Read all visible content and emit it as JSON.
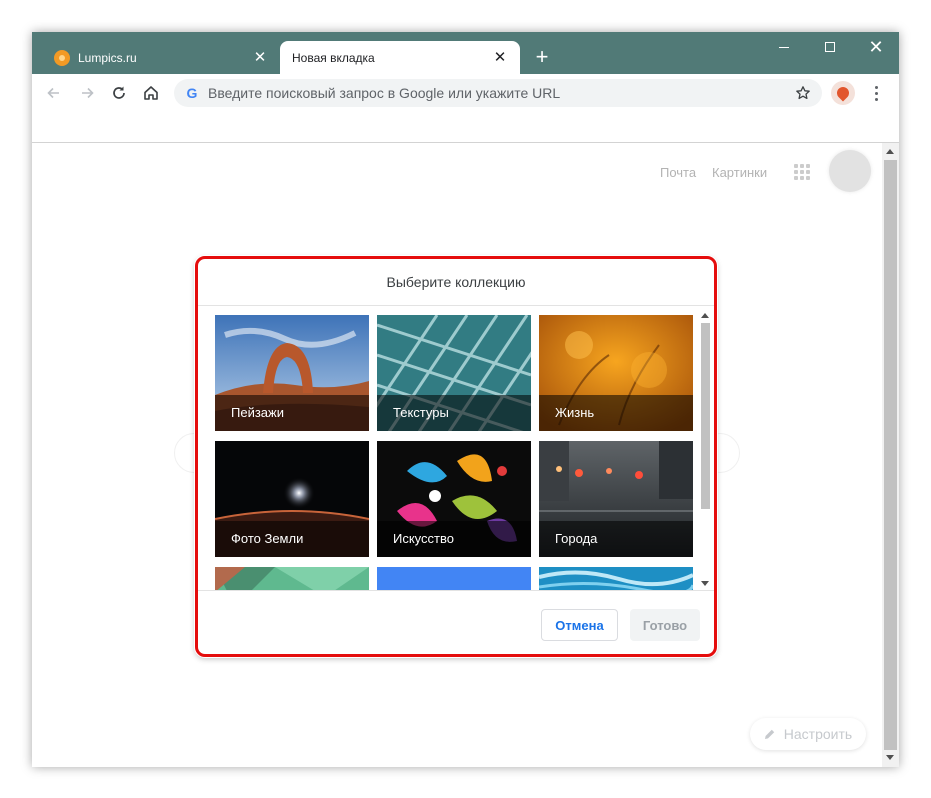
{
  "tabs": [
    {
      "title": "Lumpics.ru",
      "active": false
    },
    {
      "title": "Новая вкладка",
      "active": true
    }
  ],
  "new_tab_label": "+",
  "window_controls": {
    "minimize_icon": "minimize-icon",
    "maximize_icon": "maximize-icon",
    "close_icon": "close-icon",
    "close_glyph": "✕"
  },
  "toolbar": {
    "omnibox_placeholder": "Введите поисковый запрос в Google или укажите URL",
    "google_icon_glyph": "G"
  },
  "google_links": {
    "mail": "Почта",
    "images": "Картинки"
  },
  "dialog": {
    "title": "Выберите коллекцию",
    "collections": [
      {
        "label": "Пейзажи",
        "theme": "landscape-arch"
      },
      {
        "label": "Текстуры",
        "theme": "glass-texture"
      },
      {
        "label": "Жизнь",
        "theme": "autumn-orange"
      },
      {
        "label": "Фото Земли",
        "theme": "earth-from-space"
      },
      {
        "label": "Искусство",
        "theme": "paint-splash"
      },
      {
        "label": "Города",
        "theme": "rainy-city"
      },
      {
        "label": "",
        "theme": "geometric-green"
      },
      {
        "label": "",
        "theme": "solid-blue"
      },
      {
        "label": "",
        "theme": "ocean-wave"
      }
    ],
    "cancel_label": "Отмена",
    "done_label": "Готово"
  },
  "customize_label": "Настроить",
  "colors": {
    "frame": "#517a77",
    "dialog_border": "#e50d0d",
    "accent": "#1a73e8"
  }
}
